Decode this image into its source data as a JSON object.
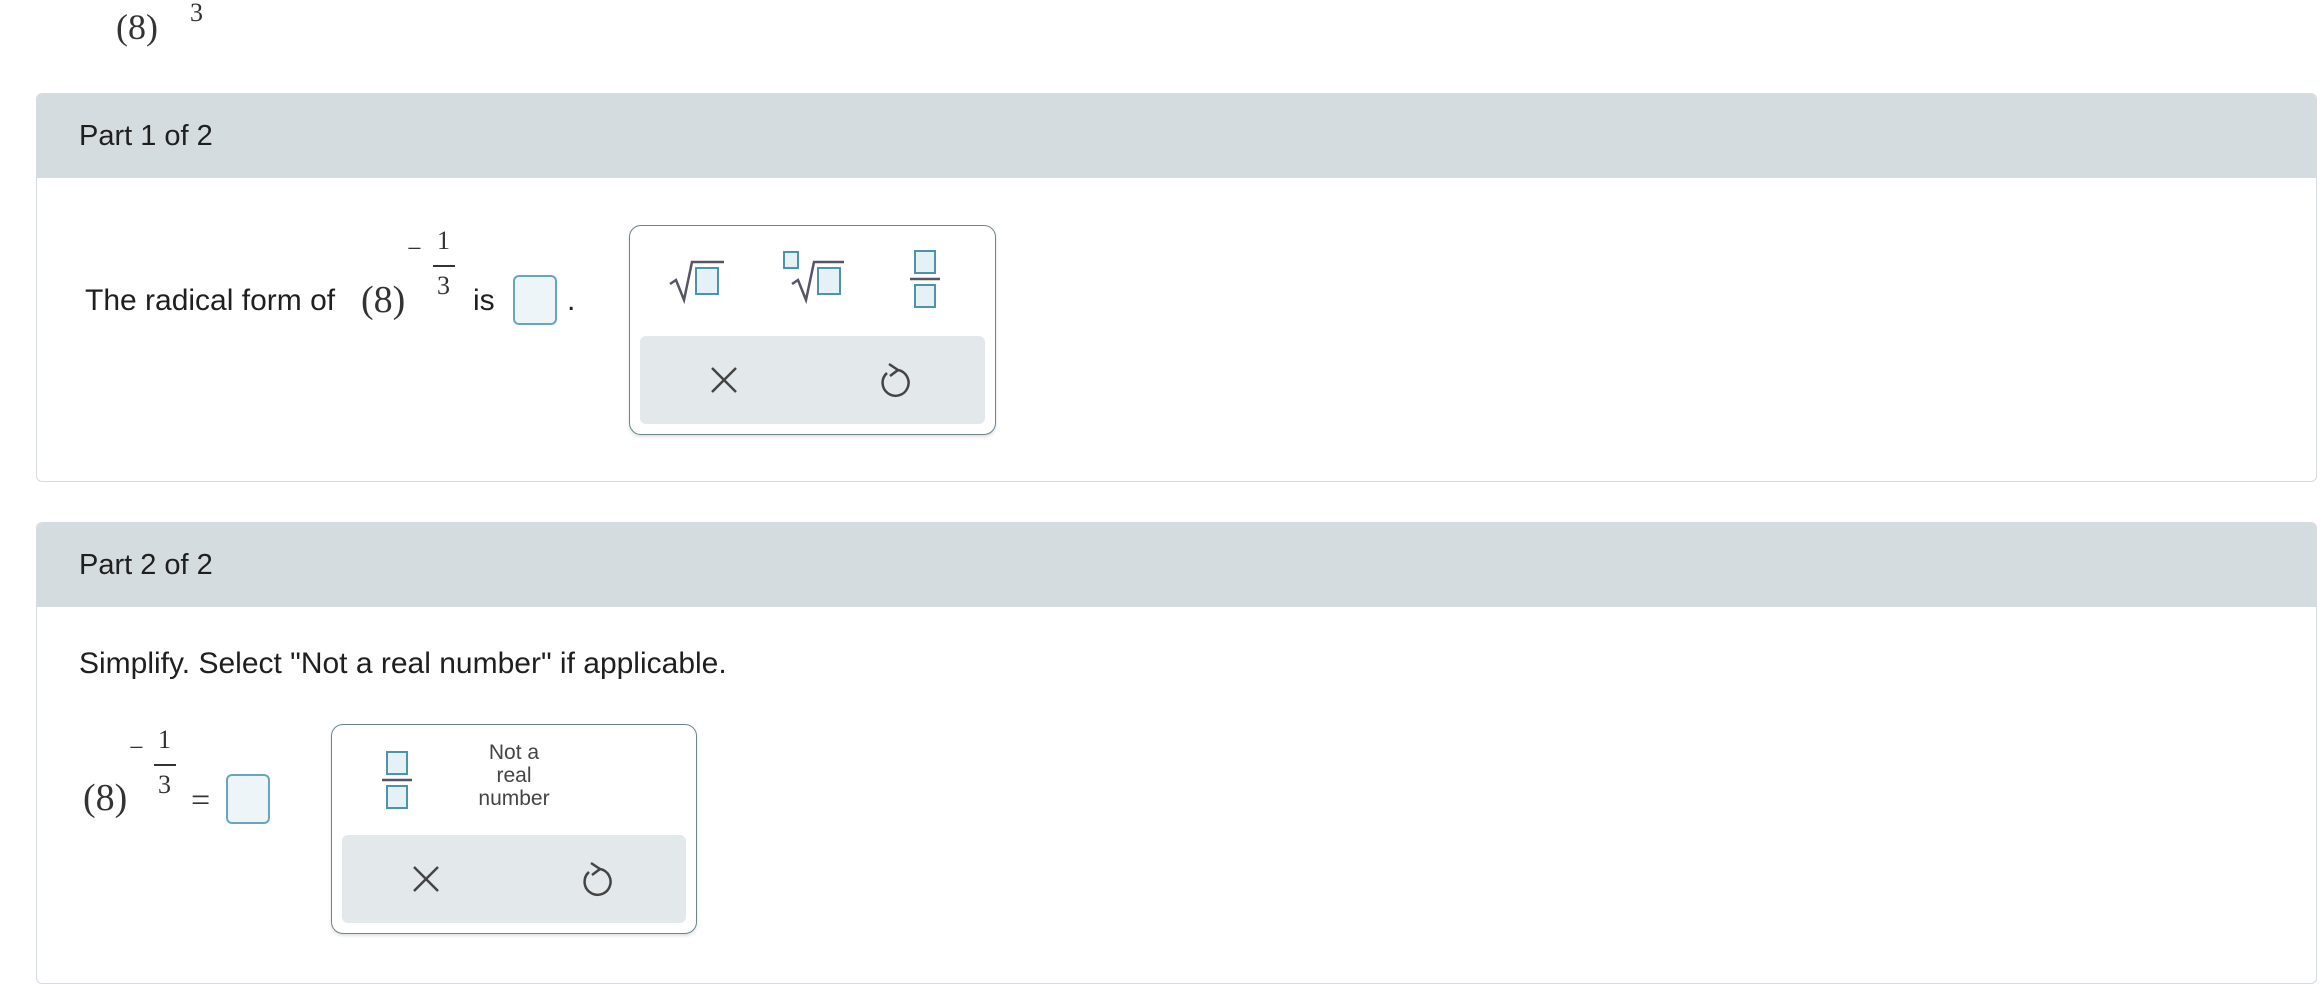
{
  "top_expr": {
    "base": "(8)",
    "exponent_fragment": "3"
  },
  "part1": {
    "header": "Part 1 of 2",
    "prompt_prefix": "The radical form of",
    "base": "(8)",
    "exp_sign": "−",
    "exp_num": "1",
    "exp_den": "3",
    "prompt_mid": "is",
    "prompt_end": ".",
    "palette": {
      "buttons": [
        "square-root",
        "nth-root",
        "fraction"
      ],
      "tray": [
        "clear",
        "undo"
      ]
    }
  },
  "part2": {
    "header": "Part 2 of 2",
    "instruction": "Simplify. Select \"Not a real number\" if applicable.",
    "base": "(8)",
    "exp_sign": "−",
    "exp_num": "1",
    "exp_den": "3",
    "equals": "=",
    "palette": {
      "buttons": [
        "fraction"
      ],
      "not_real": [
        "Not a",
        "real",
        "number"
      ],
      "tray": [
        "clear",
        "undo"
      ]
    }
  },
  "colors": {
    "header_bg": "#d5dcdf",
    "accent": "#4d93ad",
    "answer_box_fill": "#eef5f8"
  }
}
